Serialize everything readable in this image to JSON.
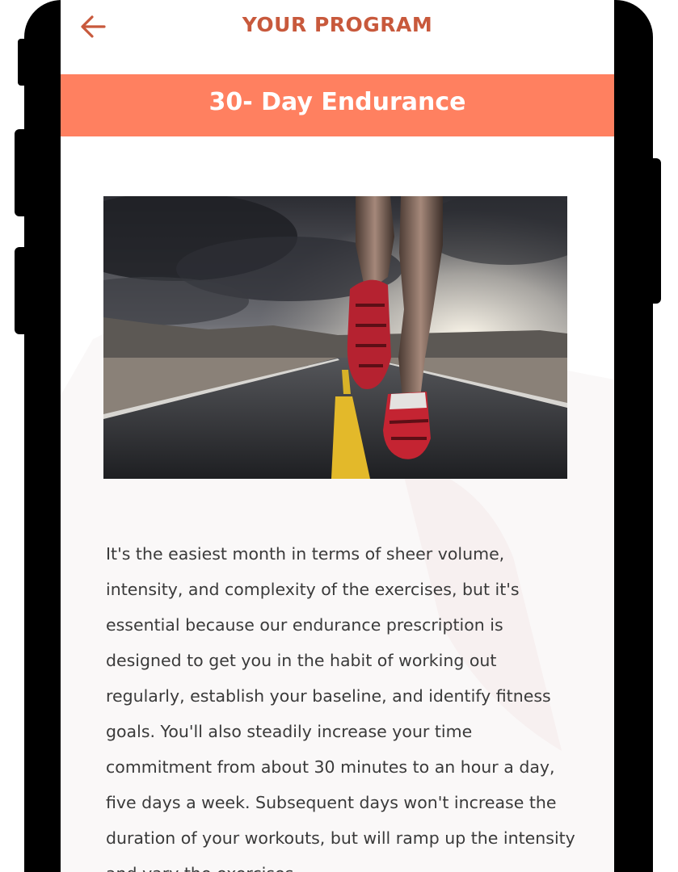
{
  "header": {
    "title": "YOUR PROGRAM",
    "back_icon": "arrow-left-icon"
  },
  "program": {
    "name": "30- Day Endurance",
    "image_icon": "runner-on-road-image",
    "description": "It's the easiest month in terms of sheer volume, intensity, and complexity of the exercises, but it's essential because our endurance prescription is designed to get you in the habit of working out regularly, establish your baseline, and identify fitness goals. You'll also steadily increase your time commitment from about 30 minutes to an hour a day, five days a week. Subsequent days won't increase the duration of your workouts, but will ramp up the intensity and vary the exercises."
  },
  "colors": {
    "accent": "#ff8060",
    "title": "#c8593c",
    "text": "#3a3a3a",
    "frame": "#000000"
  }
}
